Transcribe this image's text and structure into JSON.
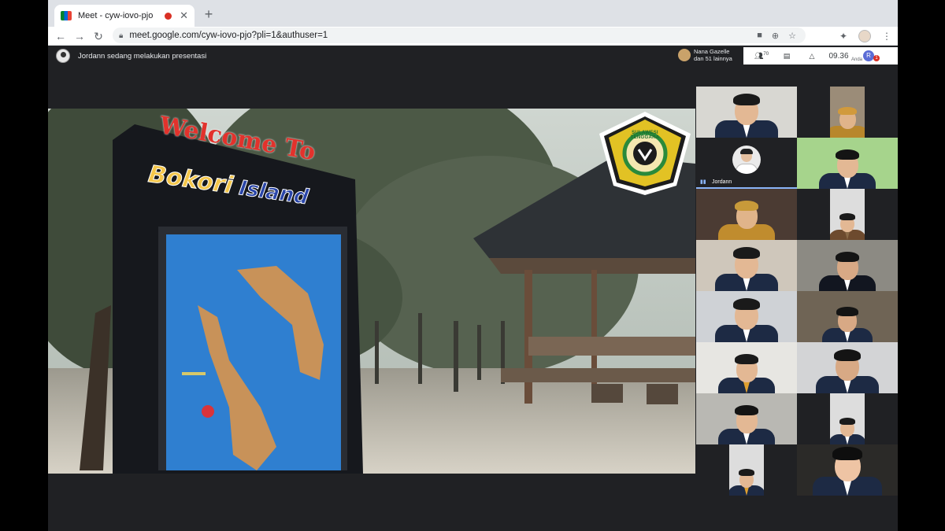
{
  "browser": {
    "tab_title": "Meet - cyw-iovo-pjo",
    "new_tab": "+",
    "close_glyph": "✕",
    "url": "meet.google.com/cyw-iovo-pjo?pli=1&authuser=1",
    "icons": [
      "camera-icon",
      "zoom-icon",
      "star-icon",
      "extensions-icon",
      "profile-icon",
      "menu-icon"
    ]
  },
  "meet": {
    "presenter_text": "Jordann sedang melakukan presentasi",
    "joined_line1": "Nana Gazelle",
    "joined_line2": "dan 51 lainnya",
    "people_count": "70",
    "clock": "09.36",
    "you_label": "Anda",
    "you_initial": "R",
    "notification_count": "1",
    "accent_color": "#8ab4f8"
  },
  "presentation": {
    "sign_top": "Welcome To",
    "sign_main_1": "Bokori",
    "sign_main_2": "Island",
    "logo_text": "SULAWESI TENGGARA"
  },
  "participants": [
    {
      "id": "p1",
      "name": ""
    },
    {
      "id": "p2",
      "name": ""
    },
    {
      "id": "p3",
      "name": "Jordann",
      "presenting": true
    },
    {
      "id": "p4",
      "name": ""
    },
    {
      "id": "p5",
      "name": ""
    },
    {
      "id": "p6",
      "name": ""
    },
    {
      "id": "p7",
      "name": ""
    },
    {
      "id": "p8",
      "name": ""
    },
    {
      "id": "p9",
      "name": ""
    },
    {
      "id": "p10",
      "name": ""
    },
    {
      "id": "p11",
      "name": ""
    },
    {
      "id": "p12",
      "name": ""
    },
    {
      "id": "p13",
      "name": ""
    },
    {
      "id": "p14",
      "name": ""
    },
    {
      "id": "p15",
      "name": ""
    },
    {
      "id": "p16",
      "name": ""
    }
  ]
}
